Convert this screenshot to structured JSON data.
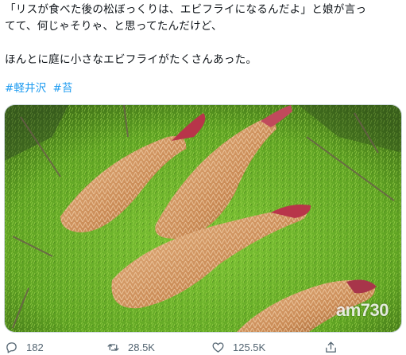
{
  "tweet": {
    "line1": "「リスが食べた後の松ぼっくりは、エビフライになるんだよ」と娘が言っ",
    "line2": "てて、何じゃそりゃ、と思ってたんだけど、",
    "line3": "ほんとに庭に小さなエビフライがたくさんあった。",
    "hashtags": [
      "#軽井沢",
      "#苔"
    ]
  },
  "media": {
    "watermark": "am730"
  },
  "actions": {
    "reply_count": "182",
    "retweet_count": "28.5K",
    "like_count": "125.5K"
  },
  "colors": {
    "link": "#1d9bf0",
    "icon": "#536471",
    "moss": "#6fb52c"
  },
  "icons": [
    "reply-icon",
    "retweet-icon",
    "like-icon",
    "share-icon"
  ]
}
